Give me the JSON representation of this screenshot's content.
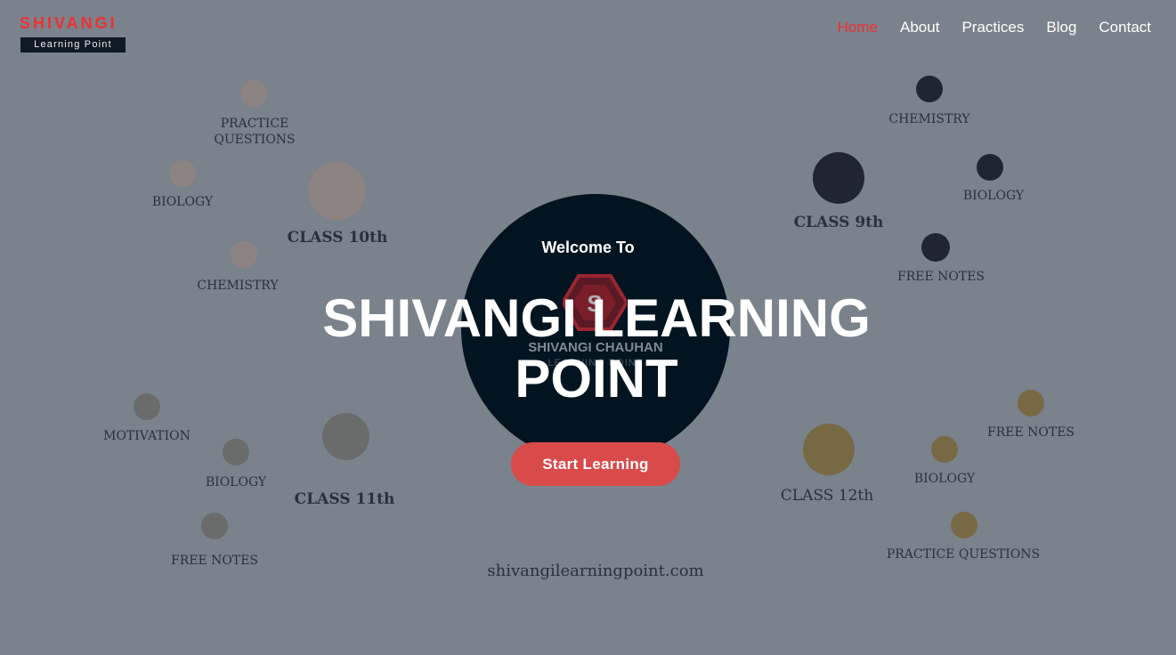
{
  "logo": {
    "brand_top": "SHIVANGI",
    "brand_bottom": "Learning Point"
  },
  "nav": {
    "items": [
      {
        "label": "Home",
        "active": true
      },
      {
        "label": "About",
        "active": false
      },
      {
        "label": "Practices",
        "active": false
      },
      {
        "label": "Blog",
        "active": false
      },
      {
        "label": "Contact",
        "active": false
      }
    ]
  },
  "colors": {
    "background": "#7a828b",
    "brand_red": "#ef2f35",
    "hero_circle": "#021420",
    "cta": "#d94a4a",
    "class10": "#8e8383",
    "class9": "#20262f",
    "class11": "#6a6c6c",
    "class12": "#786945"
  },
  "diagram": {
    "class10": {
      "title": "CLASS 10th",
      "practice": "PRACTICE QUESTIONS",
      "biology": "BIOLOGY",
      "chemistry": "CHEMISTRY"
    },
    "class9": {
      "title": "CLASS 9th",
      "chemistry": "CHEMISTRY",
      "biology": "BIOLOGY",
      "free_notes": "FREE NOTES"
    },
    "class11": {
      "title": "CLASS 11th",
      "motivation": "MOTIVATION",
      "biology": "BIOLOGY",
      "free_notes": "FREE NOTES"
    },
    "class12": {
      "title": "CLASS 12th",
      "free_notes": "FREE NOTES",
      "biology": "BIOLOGY",
      "practice": "PRACTICE QUESTIONS"
    }
  },
  "hero": {
    "welcome": "Welcome To",
    "title": "SHIVANGI LEARNING POINT",
    "emblem_text": "SHIVANGI CHAUHAN",
    "emblem_subtext": "LEARNING POINT",
    "cta_label": "Start Learning",
    "site_url": "shivangilearningpoint.com"
  }
}
